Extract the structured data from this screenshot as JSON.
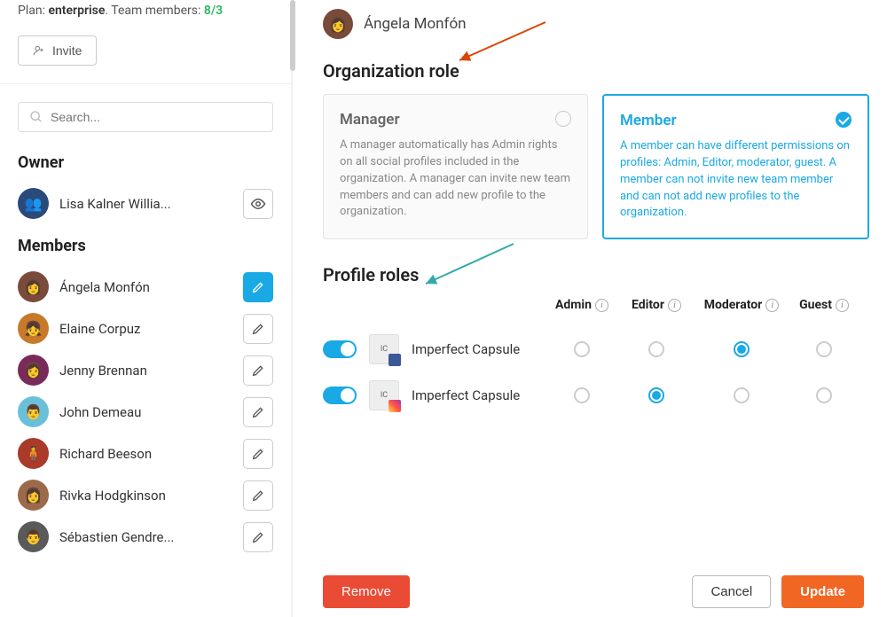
{
  "sidebar": {
    "plan_prefix": "Plan: ",
    "plan_name": "enterprise",
    "plan_team_label": ". Team members: ",
    "plan_team_count": "8/3",
    "invite_label": "Invite",
    "search_placeholder": "Search...",
    "owner_heading": "Owner",
    "members_heading": "Members",
    "owner": {
      "name": "Lisa Kalner Willia..."
    },
    "members": [
      {
        "name": "Ángela Monfón",
        "active": true
      },
      {
        "name": "Elaine Corpuz"
      },
      {
        "name": "Jenny Brennan"
      },
      {
        "name": "John Demeau"
      },
      {
        "name": "Richard Beeson"
      },
      {
        "name": "Rivka Hodgkinson"
      },
      {
        "name": "Sébastien Gendre..."
      }
    ]
  },
  "main": {
    "user_name": "Ángela Monfón",
    "org_role_heading": "Organization role",
    "roles": {
      "manager": {
        "title": "Manager",
        "desc": "A manager automatically has Admin rights on all social profiles included in the organization. A manager can invite new team members and can add new profile to the organization."
      },
      "member": {
        "title": "Member",
        "desc": "A member can have different permissions on profiles: Admin, Editor, moderator, guest. A member can not invite new team member and can not add new profiles to the organization."
      }
    },
    "profile_roles_heading": "Profile roles",
    "columns": {
      "admin": "Admin",
      "editor": "Editor",
      "moderator": "Moderator",
      "guest": "Guest"
    },
    "profiles": [
      {
        "name": "Imperfect Capsule",
        "network": "fb",
        "enabled": true,
        "role": "moderator"
      },
      {
        "name": "Imperfect Capsule",
        "network": "ig",
        "enabled": true,
        "role": "editor"
      }
    ],
    "footer": {
      "remove": "Remove",
      "cancel": "Cancel",
      "update": "Update"
    }
  }
}
